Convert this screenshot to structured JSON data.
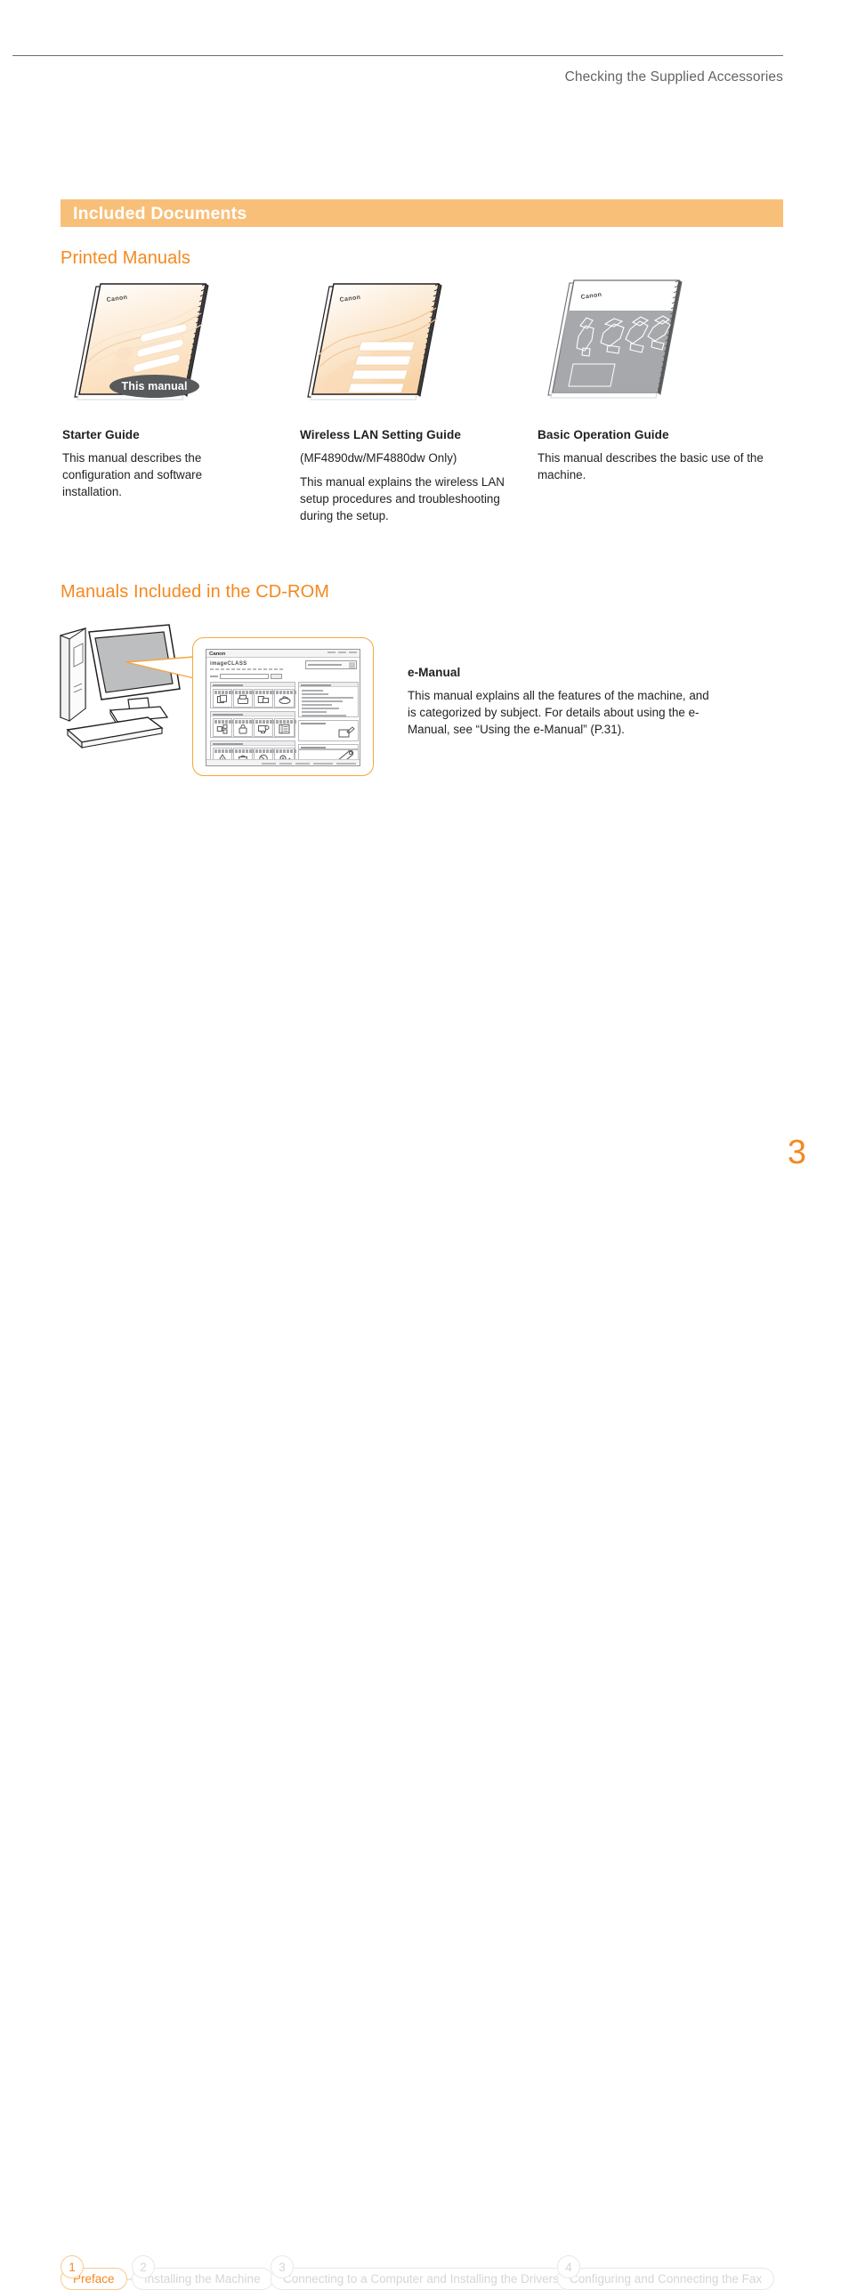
{
  "header": {
    "title": "Checking the Supplied Accessories"
  },
  "section": {
    "title": "Included Documents"
  },
  "printed_manuals": {
    "heading": "Printed Manuals",
    "badge_label": "This manual",
    "items": [
      {
        "title": "Starter Guide",
        "subtitle": "",
        "body": "This manual describes the configuration and software installation.",
        "cover_style": "orange-wave",
        "badge": "This manual"
      },
      {
        "title": "Wireless LAN Setting Guide",
        "subtitle": "(MF4890dw/MF4880dw Only)",
        "body": "This manual explains the wireless LAN setup procedures and troubleshooting during the setup.",
        "cover_style": "orange-wave",
        "badge": ""
      },
      {
        "title": "Basic Operation Guide",
        "subtitle": "",
        "body": "This manual describes the basic use of the machine.",
        "cover_style": "gray-photo",
        "badge": ""
      }
    ]
  },
  "cdrom_manuals": {
    "heading": "Manuals Included in the CD-ROM",
    "emanual": {
      "title": "e-Manual",
      "body": "This manual explains all the features of the machine, and is categorized by subject. For details about using the e-Manual, see “Using the e-Manual” (P.31)."
    },
    "screenshot": {
      "brand": "imageCLASS",
      "logo": "Canon"
    }
  },
  "footer_nav": {
    "steps": [
      {
        "number": "1",
        "label": "Preface",
        "active": true
      },
      {
        "number": "2",
        "label": "Installing the Machine",
        "active": false
      },
      {
        "number": "3",
        "label": "Connecting to a Computer and Installing the Drivers",
        "active": false
      },
      {
        "number": "4",
        "label": "Configuring and Connecting the Fax",
        "active": false
      }
    ]
  },
  "page_number": "3",
  "colors": {
    "accent": "#f5881f",
    "bar": "#f8bf79",
    "badge": "#58595b",
    "text": "#231f20",
    "muted": "#636466"
  }
}
